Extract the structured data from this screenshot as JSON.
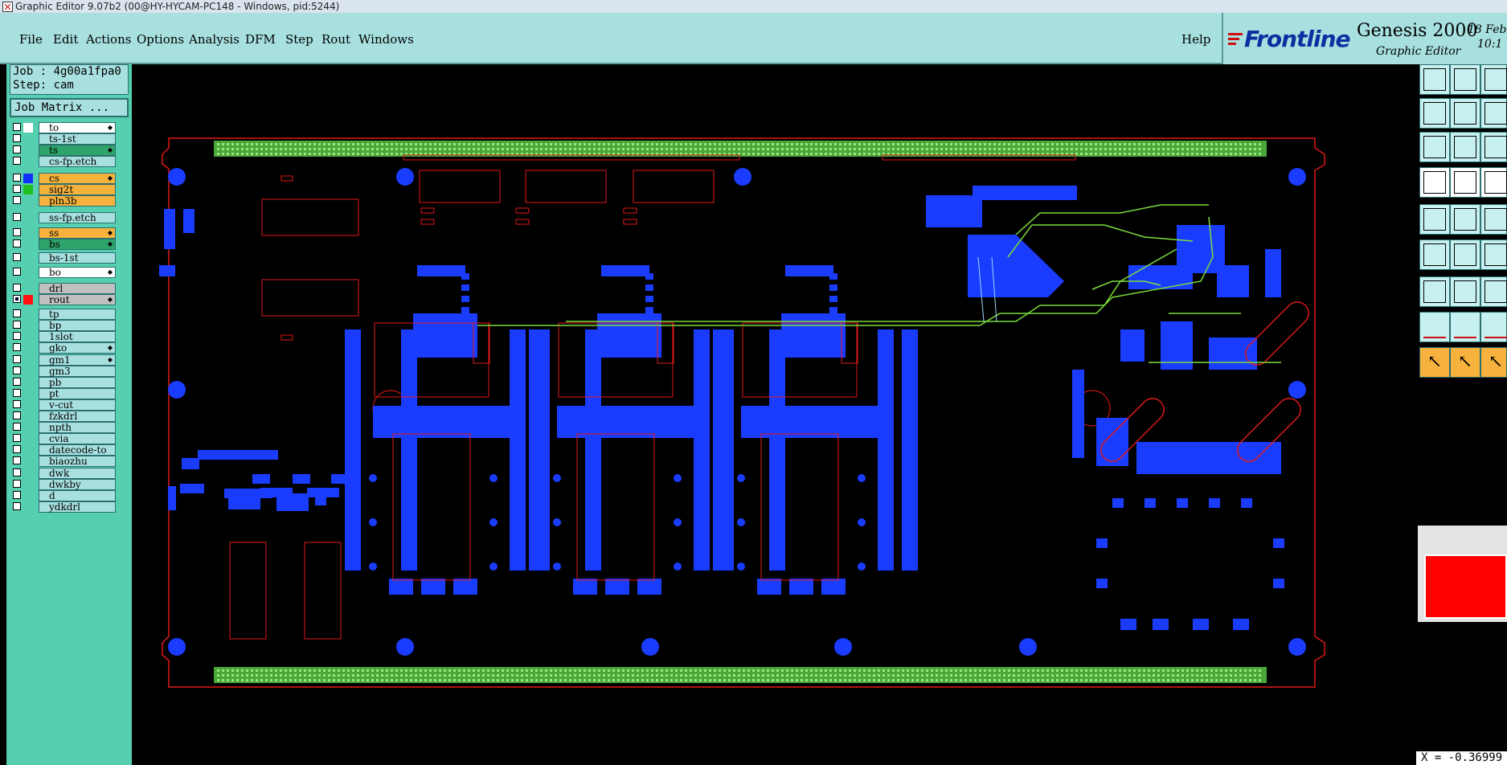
{
  "window": {
    "title": "Graphic Editor 9.07b2 (00@HY-HYCAM-PC148 - Windows, pid:5244)"
  },
  "menu": {
    "items": [
      {
        "label": "File"
      },
      {
        "label": "Edit"
      },
      {
        "label": "Actions"
      },
      {
        "label": "Options"
      },
      {
        "label": "Analysis"
      },
      {
        "label": "DFM"
      },
      {
        "label": "Step"
      },
      {
        "label": "Rout"
      },
      {
        "label": "Windows"
      }
    ],
    "help": "Help"
  },
  "brand": {
    "logo": "Frontline",
    "product": "Genesis 2000",
    "subtitle": "Graphic Editor",
    "date": "18 Feb",
    "time": "10:1"
  },
  "job": {
    "job_line": "Job : 4g00a1fpa0",
    "step_line": "Step: cam",
    "matrix_button": "Job Matrix ..."
  },
  "layers": [
    {
      "name": "to",
      "swatch": "#ffffff",
      "active": false,
      "highlight": "#ffffff",
      "affected": true
    },
    {
      "name": "ts-1st",
      "swatch": "#55cfb0",
      "active": false,
      "highlight": "#a8e0e0",
      "affected": false
    },
    {
      "name": "ts",
      "swatch": "#55cfb0",
      "active": false,
      "highlight": "#2ea36a",
      "affected": true
    },
    {
      "name": "cs-fp.etch",
      "swatch": "#55cfb0",
      "active": false,
      "highlight": "#a8e0e0",
      "affected": false
    },
    {
      "name": "cs",
      "swatch": "#1030ff",
      "active": false,
      "highlight": "#f6b23c",
      "affected": true
    },
    {
      "name": "sig2t",
      "swatch": "#20c020",
      "active": false,
      "highlight": "#f6b23c",
      "affected": false
    },
    {
      "name": "pln3b",
      "swatch": "#55cfb0",
      "active": false,
      "highlight": "#f6b23c",
      "affected": false
    },
    {
      "name": "ss-fp.etch",
      "swatch": "#55cfb0",
      "active": false,
      "highlight": "#a8e0e0",
      "affected": false
    },
    {
      "name": "ss",
      "swatch": "#55cfb0",
      "active": false,
      "highlight": "#f6b23c",
      "affected": true
    },
    {
      "name": "bs",
      "swatch": "#55cfb0",
      "active": false,
      "highlight": "#2ea36a",
      "affected": true
    },
    {
      "name": "bs-1st",
      "swatch": "#55cfb0",
      "active": false,
      "highlight": "#a8e0e0",
      "affected": false
    },
    {
      "name": "bo",
      "swatch": "#55cfb0",
      "active": false,
      "highlight": "#ffffff",
      "affected": true
    },
    {
      "name": "drl",
      "swatch": "#55cfb0",
      "active": false,
      "highlight": "#c0c0c0",
      "affected": false
    },
    {
      "name": "rout",
      "swatch": "#ff1010",
      "active": true,
      "highlight": "#c0c0c0",
      "affected": true
    },
    {
      "name": "tp",
      "swatch": "#55cfb0",
      "active": false,
      "highlight": "#a8e0e0",
      "affected": false
    },
    {
      "name": "bp",
      "swatch": "#55cfb0",
      "active": false,
      "highlight": "#a8e0e0",
      "affected": false
    },
    {
      "name": "1slot",
      "swatch": "#55cfb0",
      "active": false,
      "highlight": "#a8e0e0",
      "affected": false
    },
    {
      "name": "gko",
      "swatch": "#55cfb0",
      "active": false,
      "highlight": "#a8e0e0",
      "affected": true
    },
    {
      "name": "gm1",
      "swatch": "#55cfb0",
      "active": false,
      "highlight": "#a8e0e0",
      "affected": true
    },
    {
      "name": "gm3",
      "swatch": "#55cfb0",
      "active": false,
      "highlight": "#a8e0e0",
      "affected": false
    },
    {
      "name": "pb",
      "swatch": "#55cfb0",
      "active": false,
      "highlight": "#a8e0e0",
      "affected": false
    },
    {
      "name": "pt",
      "swatch": "#55cfb0",
      "active": false,
      "highlight": "#a8e0e0",
      "affected": false
    },
    {
      "name": "v-cut",
      "swatch": "#55cfb0",
      "active": false,
      "highlight": "#a8e0e0",
      "affected": false
    },
    {
      "name": "fzkdrl",
      "swatch": "#55cfb0",
      "active": false,
      "highlight": "#a8e0e0",
      "affected": false
    },
    {
      "name": "npth",
      "swatch": "#55cfb0",
      "active": false,
      "highlight": "#a8e0e0",
      "affected": false
    },
    {
      "name": "cvia",
      "swatch": "#55cfb0",
      "active": false,
      "highlight": "#a8e0e0",
      "affected": false
    },
    {
      "name": "datecode-to",
      "swatch": "#55cfb0",
      "active": false,
      "highlight": "#a8e0e0",
      "affected": false
    },
    {
      "name": "biaozhu",
      "swatch": "#55cfb0",
      "active": false,
      "highlight": "#a8e0e0",
      "affected": false
    },
    {
      "name": "dwk",
      "swatch": "#55cfb0",
      "active": false,
      "highlight": "#a8e0e0",
      "affected": false
    },
    {
      "name": "dwkby",
      "swatch": "#55cfb0",
      "active": false,
      "highlight": "#a8e0e0",
      "affected": false
    },
    {
      "name": "d",
      "swatch": "#55cfb0",
      "active": false,
      "highlight": "#a8e0e0",
      "affected": false
    },
    {
      "name": "ydkdrl",
      "swatch": "#55cfb0",
      "active": false,
      "highlight": "#a8e0e0",
      "affected": false
    }
  ],
  "tools": [
    {
      "name": "zoom-home-icon",
      "variant": "normal"
    },
    {
      "name": "zoom-out-icon",
      "variant": "normal"
    },
    {
      "name": "zoom-fit-icon",
      "variant": "normal"
    },
    {
      "name": "zoom-in-box-icon",
      "variant": "normal"
    },
    {
      "name": "zoom-area-icon",
      "variant": "normal"
    },
    {
      "name": "zoom-one-to-one-icon",
      "variant": "normal"
    },
    {
      "name": "measure-icon",
      "variant": "normal"
    },
    {
      "name": "snap-icon",
      "variant": "normal"
    },
    {
      "name": "select-box-icon",
      "variant": "normal"
    },
    {
      "name": "view-profile-icon",
      "variant": "white"
    },
    {
      "name": "edit-shape-icon",
      "variant": "white"
    },
    {
      "name": "ruler-icon",
      "variant": "white"
    },
    {
      "name": "net-connect-icon",
      "variant": "normal"
    },
    {
      "name": "cross-cut-icon",
      "variant": "normal"
    },
    {
      "name": "arc-icon",
      "variant": "normal"
    },
    {
      "name": "add-line-icon",
      "variant": "normal"
    },
    {
      "name": "add-diagonal-icon",
      "variant": "normal"
    },
    {
      "name": "arc-tool-icon",
      "variant": "normal"
    },
    {
      "name": "add-pad-icon",
      "variant": "normal"
    },
    {
      "name": "minus-line-icon",
      "variant": "normal"
    },
    {
      "name": "break-line-icon",
      "variant": "normal"
    },
    {
      "name": "add-triangle-icon",
      "variant": "normal"
    },
    {
      "name": "add-a-triangle-icon",
      "variant": "normal"
    },
    {
      "name": "add-b-triangle-icon",
      "variant": "normal"
    },
    {
      "name": "pointer-select-icon",
      "variant": "orange"
    },
    {
      "name": "pointer-move-icon",
      "variant": "orange"
    },
    {
      "name": "pointer-copy-icon",
      "variant": "orange"
    }
  ],
  "coords": "X = -0.36999",
  "colors": {
    "board_outline": "#e01818",
    "copper": "#1a3cff",
    "connector": "#6ad64a",
    "trace": "#7adc3c",
    "panel": "#a8e0e0",
    "layer_panel": "#55cfb0"
  }
}
